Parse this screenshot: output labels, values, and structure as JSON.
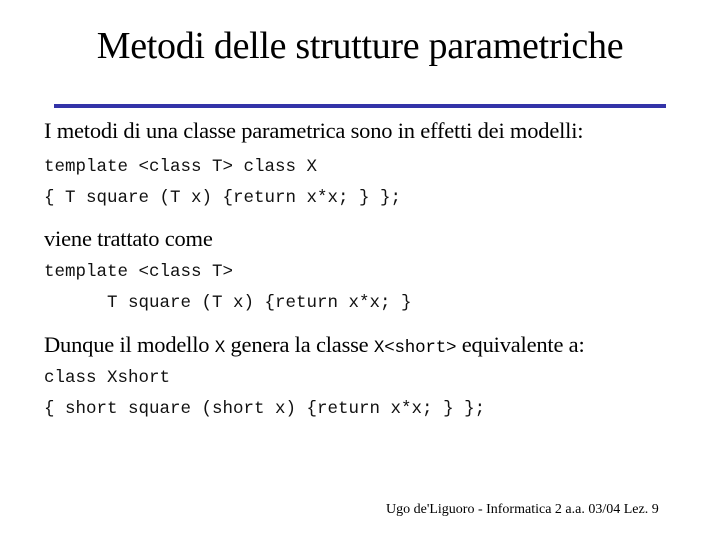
{
  "slide": {
    "title": "Metodi delle strutture parametriche",
    "accent_color": "#3333a8",
    "intro": "I metodi di una classe parametrica sono in effetti dei modelli:",
    "code1": [
      "template <class T> class X",
      "{ T square (T x) {return x*x; } };"
    ],
    "treated_as": "viene trattato come",
    "code2": [
      "template <class T>",
      "      T square (T x) {return x*x; }"
    ],
    "conclusion": {
      "part1": "Dunque il modello ",
      "code_a": "X",
      "part2": " genera la classe ",
      "code_b": "X<short>",
      "part3": " equivalente a:"
    },
    "code3": [
      "class Xshort",
      "{ short square (short x) {return x*x; } };"
    ],
    "footer": "Ugo de'Liguoro - Informatica 2 a.a. 03/04 Lez. 9"
  }
}
